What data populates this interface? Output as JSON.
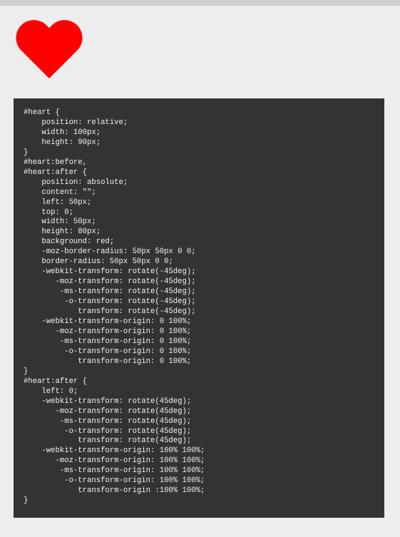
{
  "heart": {
    "icon": "heart-icon",
    "color": "#ff0000"
  },
  "code_panel": {
    "background": "#333333",
    "text_color": "#f2f2f2",
    "code": "#heart {\n    position: relative;\n    width: 100px;\n    height: 90px;\n}\n#heart:before,\n#heart:after {\n    position: absolute;\n    content: \"\";\n    left: 50px;\n    top: 0;\n    width: 50px;\n    height: 80px;\n    background: red;\n    -moz-border-radius: 50px 50px 0 0;\n    border-radius: 50px 50px 0 0;\n    -webkit-transform: rotate(-45deg);\n       -moz-transform: rotate(-45deg);\n        -ms-transform: rotate(-45deg);\n         -o-transform: rotate(-45deg);\n            transform: rotate(-45deg);\n    -webkit-transform-origin: 0 100%;\n       -moz-transform-origin: 0 100%;\n        -ms-transform-origin: 0 100%;\n         -o-transform-origin: 0 100%;\n            transform-origin: 0 100%;\n}\n#heart:after {\n    left: 0;\n    -webkit-transform: rotate(45deg);\n       -moz-transform: rotate(45deg);\n        -ms-transform: rotate(45deg);\n         -o-transform: rotate(45deg);\n            transform: rotate(45deg);\n    -webkit-transform-origin: 100% 100%;\n       -moz-transform-origin: 100% 100%;\n        -ms-transform-origin: 100% 100%;\n         -o-transform-origin: 100% 100%;\n            transform-origin :100% 100%;\n}"
  }
}
